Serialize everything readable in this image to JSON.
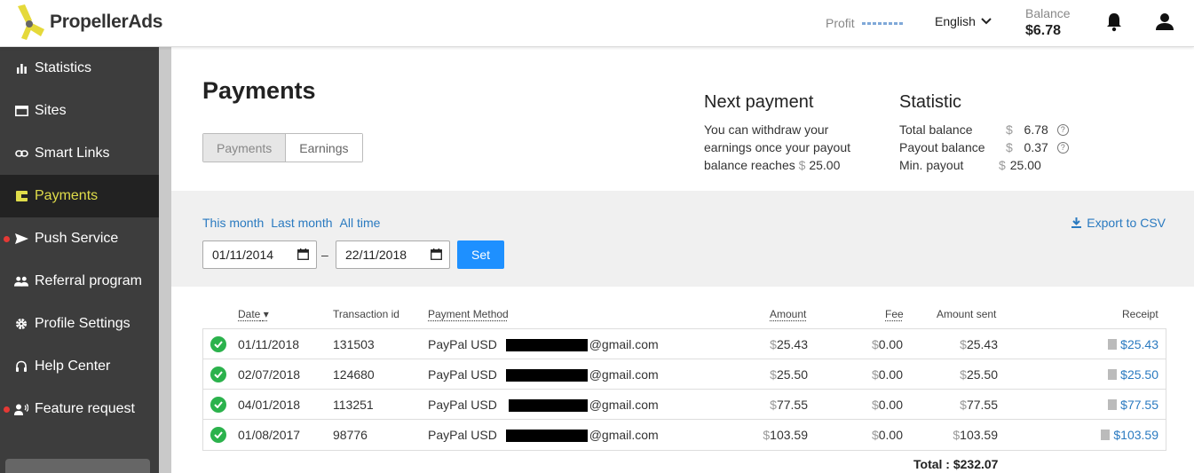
{
  "header": {
    "brand": "PropellerAds",
    "profit_label": "Profit",
    "language": "English",
    "balance_label": "Balance",
    "balance_value": "$6.78"
  },
  "sidebar": {
    "items": [
      {
        "label": "Statistics",
        "icon": "bar-chart-icon"
      },
      {
        "label": "Sites",
        "icon": "window-icon"
      },
      {
        "label": "Smart Links",
        "icon": "link-icon"
      },
      {
        "label": "Payments",
        "icon": "wallet-icon",
        "active": true
      },
      {
        "label": "Push Service",
        "icon": "send-icon",
        "dot": true
      },
      {
        "label": "Referral program",
        "icon": "people-icon"
      },
      {
        "label": "Profile Settings",
        "icon": "gear-icon"
      },
      {
        "label": "Help Center",
        "icon": "headset-icon"
      },
      {
        "label": "Feature request",
        "icon": "user-voice-icon",
        "dot": true
      }
    ]
  },
  "page": {
    "title": "Payments",
    "tabs": [
      "Payments",
      "Earnings"
    ]
  },
  "next_payment": {
    "title": "Next payment",
    "line1": "You can withdraw your",
    "line2": "earnings once your payout",
    "line3_text": "balance reaches",
    "currency": "$",
    "amount": "25.00"
  },
  "statistic": {
    "title": "Statistic",
    "rows": [
      {
        "label": "Total balance",
        "currency": "$",
        "value": "6.78",
        "help": true
      },
      {
        "label": "Payout balance",
        "currency": "$",
        "value": "0.37",
        "help": true
      },
      {
        "label": "Min. payout",
        "currency": "$",
        "value": "25.00",
        "help": false
      }
    ]
  },
  "filters": {
    "quick": [
      "This month",
      "Last month",
      "All time"
    ],
    "export_label": "Export to CSV",
    "date_from": "01/11/2014",
    "date_sep": "–",
    "date_to": "22/11/2018",
    "set_label": "Set"
  },
  "table": {
    "headers": {
      "date": "Date",
      "transaction": "Transaction id",
      "method": "Payment Method",
      "amount": "Amount",
      "fee": "Fee",
      "sent": "Amount sent",
      "receipt": "Receipt"
    },
    "rows": [
      {
        "date": "01/11/2018",
        "id": "131503",
        "method": "PayPal USD",
        "email_suffix": "@gmail.com",
        "cur": "$",
        "amount": "25.43",
        "fee": "0.00",
        "sent": "25.43",
        "receipt": "$25.43"
      },
      {
        "date": "02/07/2018",
        "id": "124680",
        "method": "PayPal USD",
        "email_suffix": "@gmail.com",
        "cur": "$",
        "amount": "25.50",
        "fee": "0.00",
        "sent": "25.50",
        "receipt": "$25.50"
      },
      {
        "date": "04/01/2018",
        "id": "113251",
        "method": "PayPal USD",
        "email_suffix": "@gmail.com",
        "cur": "$",
        "amount": "77.55",
        "fee": "0.00",
        "sent": "77.55",
        "receipt": "$77.55"
      },
      {
        "date": "01/08/2017",
        "id": "98776",
        "method": "PayPal USD",
        "email_suffix": "@gmail.com",
        "cur": "$",
        "amount": "103.59",
        "fee": "0.00",
        "sent": "103.59",
        "receipt": "$103.59"
      }
    ],
    "total": "Total : $232.07"
  },
  "colors": {
    "sidebar_bg": "#3d3d3d",
    "active_text": "#e0dd4a",
    "link": "#2a7ac0",
    "primary": "#1e90ff",
    "success": "#2bb24c"
  }
}
